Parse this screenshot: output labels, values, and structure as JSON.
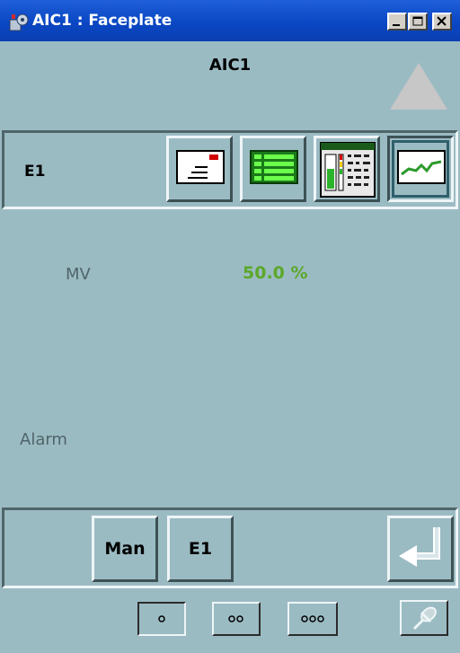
{
  "window": {
    "title": "AIC1 : Faceplate",
    "controls": [
      "minimize",
      "maximize",
      "close"
    ]
  },
  "header": {
    "tag_name": "AIC1",
    "arrow_icon": "up-triangle-icon"
  },
  "toolbar": {
    "label": "E1",
    "buttons": [
      {
        "name": "message-button",
        "icon": "envelope-icon"
      },
      {
        "name": "list-button",
        "icon": "list-grid-icon"
      },
      {
        "name": "status-display-button",
        "icon": "status-display-icon"
      },
      {
        "name": "trend-button",
        "icon": "trend-line-icon",
        "active": true
      }
    ]
  },
  "main": {
    "mv_label": "MV",
    "mv_value": "50.0 %",
    "alarm_label": "Alarm"
  },
  "bottom": {
    "man_label": "Man",
    "e1_label": "E1",
    "enter_icon": "enter-arrow-icon"
  },
  "view_sizes": [
    {
      "name": "small-view",
      "dots": 1,
      "selected": true
    },
    {
      "name": "medium-view",
      "dots": 2,
      "selected": false
    },
    {
      "name": "large-view",
      "dots": 3,
      "selected": false
    }
  ],
  "colors": {
    "background": "#9bbbc3",
    "value_green": "#5ca82a",
    "label_gray": "#4f6569",
    "titlebar_blue": "#0a47c4"
  }
}
